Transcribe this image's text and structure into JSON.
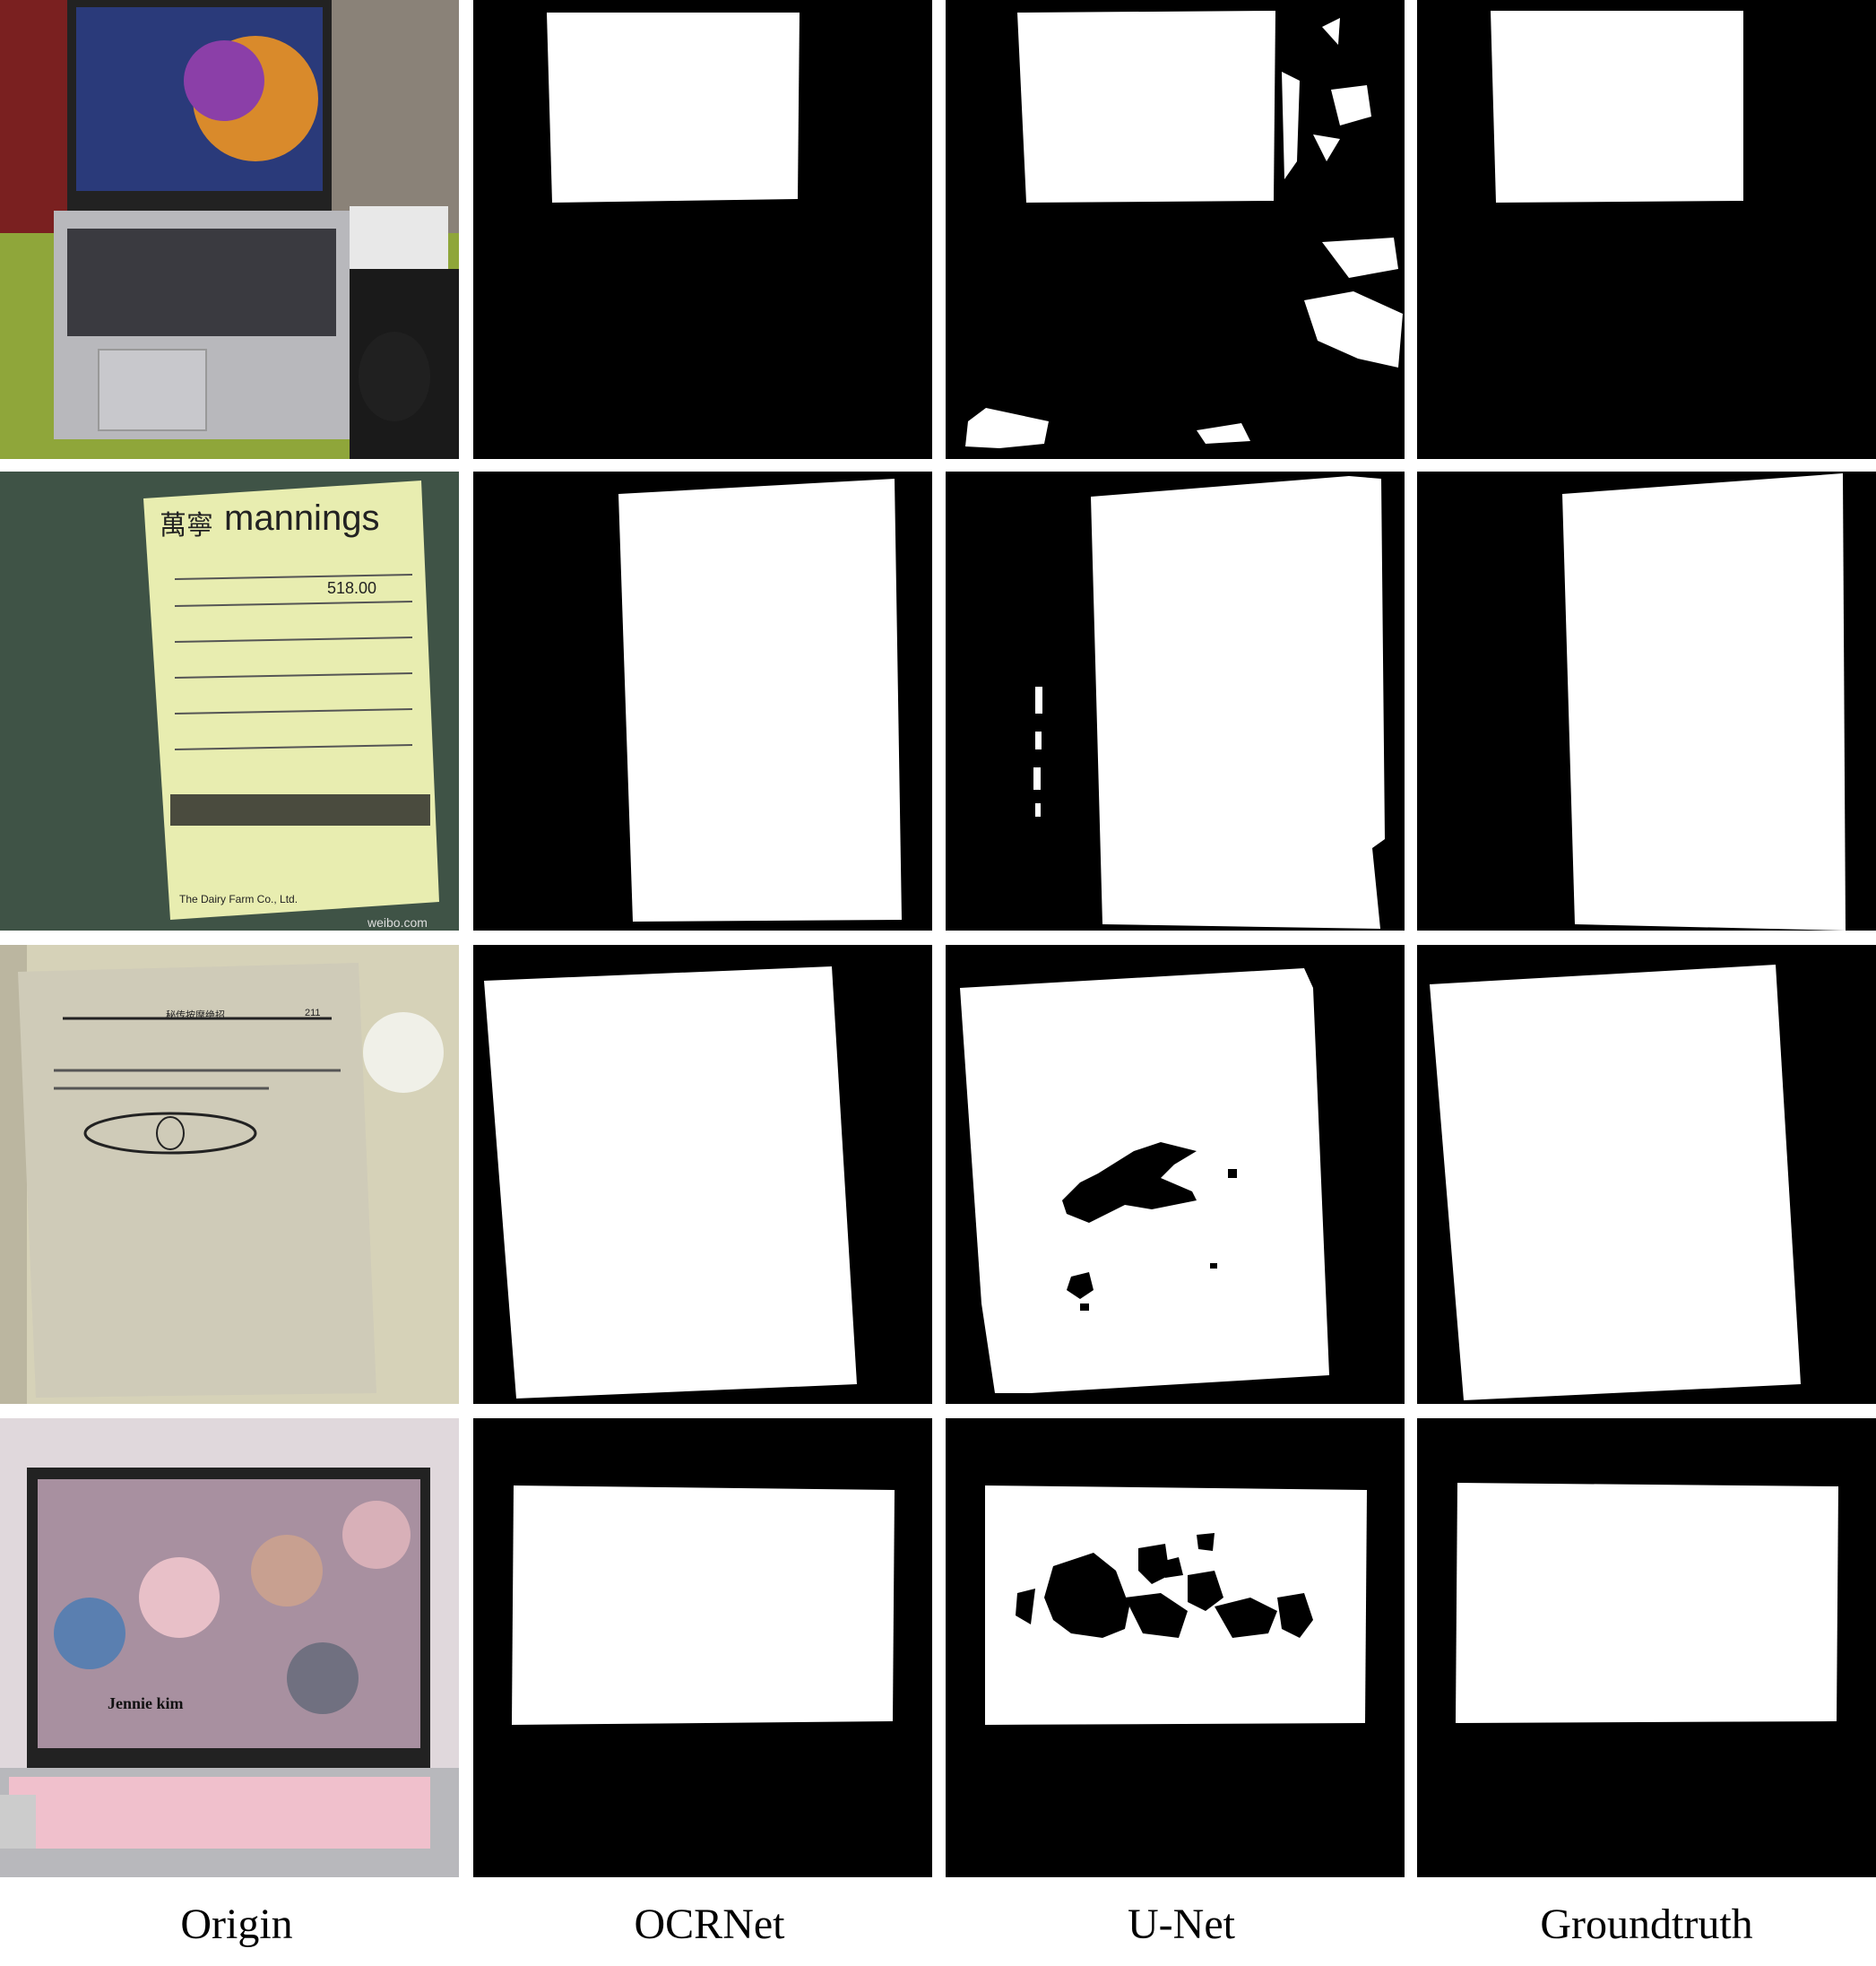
{
  "figure": {
    "columns": [
      {
        "key": "origin",
        "label": "Origin"
      },
      {
        "key": "ocrnet",
        "label": "OCRNet"
      },
      {
        "key": "unet",
        "label": "U-Net"
      },
      {
        "key": "groundtruth",
        "label": "Groundtruth"
      }
    ],
    "rows": [
      {
        "subject": "laptop"
      },
      {
        "subject": "receipt",
        "photo_text": {
          "brand_cn": "萬寧",
          "brand": "mannings",
          "amount": "518.00",
          "footer": "The Dairy Farm Co., Ltd.",
          "watermark": "weibo.com"
        }
      },
      {
        "subject": "book page",
        "photo_text": {
          "header_title": "秘传按摩绝招",
          "page_number": "211"
        }
      },
      {
        "subject": "laptop",
        "photo_text": {
          "caption": "Jennie kim"
        }
      }
    ],
    "colors": {
      "mask_foreground": "#ffffff",
      "mask_background": "#000000"
    }
  }
}
